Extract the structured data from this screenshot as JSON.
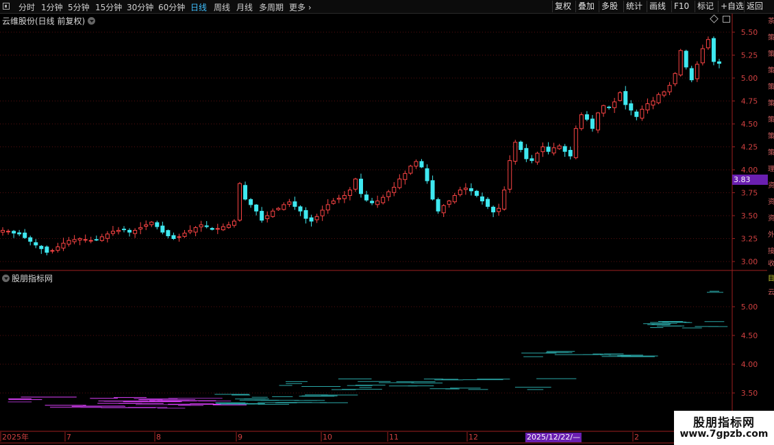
{
  "toolbar": {
    "periods": [
      "分时",
      "1分钟",
      "5分钟",
      "15分钟",
      "30分钟",
      "60分钟",
      "日线",
      "周线",
      "月线",
      "多周期",
      "更多"
    ],
    "active_period": "日线",
    "buttons": [
      "复权",
      "叠加",
      "多股",
      "统计",
      "画线",
      "F10",
      "标记",
      "+自选",
      "返回"
    ]
  },
  "main_panel": {
    "title": "云维股份(日线 前复权)",
    "last_price_tag": "3.83",
    "y_ticks": [
      "5.50",
      "5.25",
      "5.00",
      "4.75",
      "4.50",
      "4.25",
      "4.00",
      "3.75",
      "3.50",
      "3.25",
      "3.00"
    ]
  },
  "sub_panel": {
    "title": "股朋指标网",
    "y_ticks": [
      "5.00",
      "4.50",
      "4.00",
      "3.50"
    ]
  },
  "x_axis": {
    "labels": [
      "2025年",
      "7",
      "8",
      "9",
      "10",
      "11",
      "12",
      "2"
    ],
    "cursor_date": "2025/12/22/—"
  },
  "watermark": {
    "title": "股朋指标网",
    "url": "www.7gpzb.com"
  },
  "colors": {
    "up": "#ff4545",
    "down": "#3fe8f0",
    "grid": "#5a1010",
    "purple": "#6a1fb0",
    "magenta": "#e040ff",
    "teal": "#2aa8a8"
  },
  "chart_data": {
    "type": "candlestick",
    "ylim": [
      2.95,
      5.6
    ],
    "closes": [
      3.34,
      3.33,
      3.31,
      3.3,
      3.26,
      3.22,
      3.18,
      3.14,
      3.1,
      3.12,
      3.16,
      3.2,
      3.23,
      3.24,
      3.25,
      3.24,
      3.23,
      3.24,
      3.27,
      3.3,
      3.33,
      3.34,
      3.35,
      3.32,
      3.34,
      3.37,
      3.4,
      3.43,
      3.38,
      3.32,
      3.28,
      3.25,
      3.27,
      3.31,
      3.34,
      3.37,
      3.4,
      3.38,
      3.35,
      3.36,
      3.38,
      3.4,
      3.44,
      3.85,
      3.68,
      3.62,
      3.55,
      3.45,
      3.5,
      3.55,
      3.58,
      3.62,
      3.65,
      3.6,
      3.55,
      3.47,
      3.44,
      3.49,
      3.56,
      3.62,
      3.66,
      3.69,
      3.72,
      3.78,
      3.9,
      3.74,
      3.67,
      3.64,
      3.66,
      3.7,
      3.76,
      3.81,
      3.9,
      3.96,
      4.04,
      4.09,
      4.03,
      3.88,
      3.68,
      3.55,
      3.61,
      3.66,
      3.72,
      3.78,
      3.8,
      3.77,
      3.72,
      3.66,
      3.6,
      3.54,
      3.58,
      3.78,
      4.1,
      4.3,
      4.22,
      4.12,
      4.1,
      4.18,
      4.25,
      4.2,
      4.24,
      4.26,
      4.2,
      4.15,
      4.45,
      4.6,
      4.55,
      4.45,
      4.62,
      4.7,
      4.68,
      4.74,
      4.84,
      4.71,
      4.65,
      4.58,
      4.66,
      4.72,
      4.75,
      4.82,
      4.85,
      4.92,
      5.05,
      5.3,
      5.12,
      4.98,
      5.15,
      5.32,
      5.42,
      5.18,
      5.16
    ]
  }
}
